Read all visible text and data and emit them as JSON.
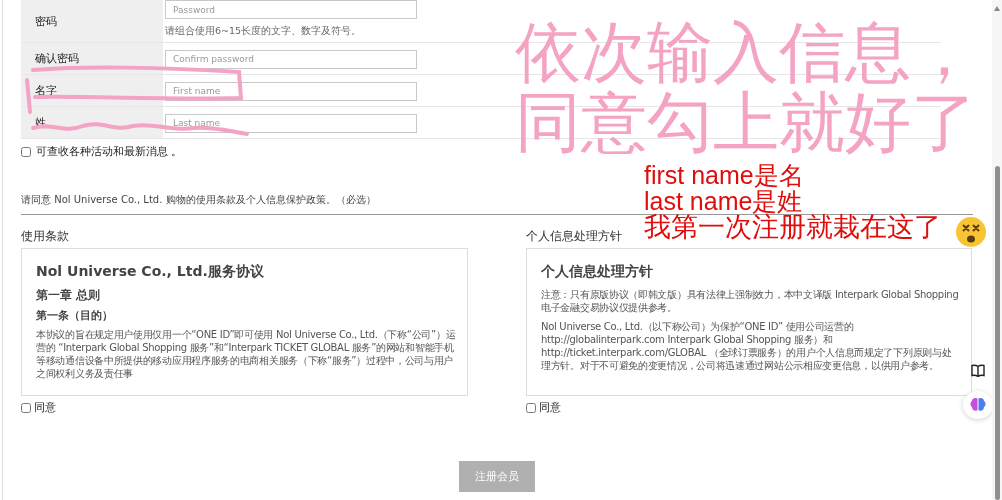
{
  "form": {
    "rows": [
      {
        "label": "密码",
        "placeholder": "Password",
        "hint": "请组合使用6~15长度的文字、数字及符号。"
      },
      {
        "label": "确认密码",
        "placeholder": "Confirm password"
      },
      {
        "label": "名字",
        "placeholder": "First name"
      },
      {
        "label": "姓",
        "placeholder": "Last name"
      }
    ]
  },
  "newsletter": {
    "label": "可查收各种活动和最新消息 。",
    "checked": false
  },
  "terms_intro": "请同意 Nol Universe Co., Ltd. 购物的使用条款及个人信息保护政策。（必选）",
  "agreements": [
    {
      "title": "使用条款",
      "blocks": [
        {
          "kind": "h1",
          "text": "Nol Universe Co., Ltd.服务协议"
        },
        {
          "kind": "h2",
          "text": "第一章 总则"
        },
        {
          "kind": "h3",
          "text": "第一条（目的）"
        },
        {
          "kind": "p",
          "text": "本协议的旨在规定用户使用仅用一个“ONE ID”即可使用 Nol Universe Co., Ltd.（下称“公司”）运营的 “Interpark Global Shopping 服务”和“Interpark TICKET GLOBAL 服务”的网站和智能手机等移动通信设备中所提供的移动应用程序服务的电商相关服务（下称“服务”）过程中，公司与用户之间权利义务及责任事"
        }
      ],
      "agree": {
        "label": "同意",
        "checked": false
      }
    },
    {
      "title": "个人信息处理方针",
      "blocks": [
        {
          "kind": "h1",
          "text": "个人信息处理方针"
        },
        {
          "kind": "p",
          "text": "注意：只有原版协议（即韩文版）具有法律上强制效力，本中文译版 Interpark Global Shopping 电子金融交易协议仅提供参考。"
        },
        {
          "kind": "p",
          "text": "Nol Universe Co., Ltd.（以下称公司）为保护“ONE ID” 使用公司运营的 http://globalinterpark.com Interpark Global Shopping 服务）和 http://ticket.interpark.com/GLOBAL （全球订票服务）的用户个人信息而规定了下列原则与处理方针。对于不可避免的变更情况，公司将迅速通过网站公示相应变更信息，以供用户参考。"
        }
      ],
      "agree": {
        "label": "同意",
        "checked": false
      }
    }
  ],
  "submit": {
    "label": "注册会员",
    "disabled": true
  },
  "annotations": {
    "headline": [
      "依次输入信息，",
      "同意勾上就好了"
    ],
    "notes": [
      "first name是名",
      "last name是姓",
      "我第一次注册就栽在这了"
    ]
  }
}
